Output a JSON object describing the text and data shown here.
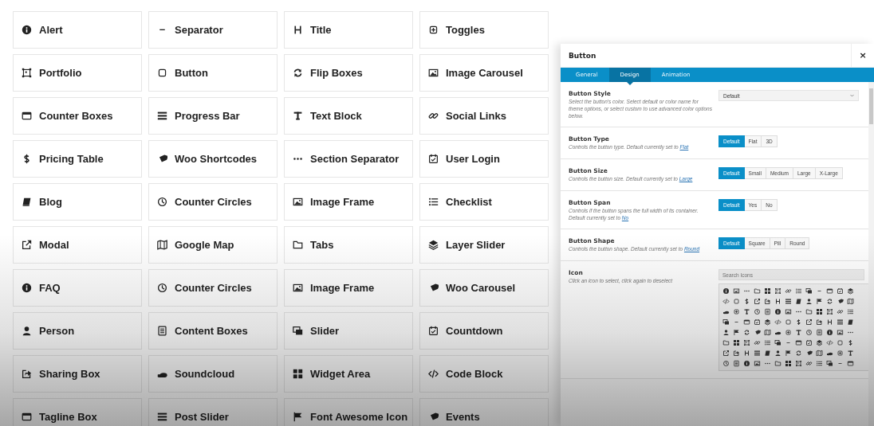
{
  "elements": [
    {
      "label": "Alert"
    },
    {
      "label": "Separator"
    },
    {
      "label": "Title"
    },
    {
      "label": "Toggles"
    },
    {
      "label": "Portfolio"
    },
    {
      "label": "Button"
    },
    {
      "label": "Flip Boxes"
    },
    {
      "label": "Image Carousel"
    },
    {
      "label": "Counter Boxes"
    },
    {
      "label": "Progress Bar"
    },
    {
      "label": "Text Block"
    },
    {
      "label": "Social Links"
    },
    {
      "label": "Pricing Table"
    },
    {
      "label": "Woo Shortcodes"
    },
    {
      "label": "Section Separator"
    },
    {
      "label": "User Login"
    },
    {
      "label": "Blog"
    },
    {
      "label": "Counter Circles"
    },
    {
      "label": "Image Frame"
    },
    {
      "label": "Checklist"
    },
    {
      "label": "Modal"
    },
    {
      "label": "Google Map"
    },
    {
      "label": "Tabs"
    },
    {
      "label": "Layer Slider"
    },
    {
      "label": "FAQ"
    },
    {
      "label": "Counter Circles"
    },
    {
      "label": "Image Frame"
    },
    {
      "label": "Woo Carousel"
    },
    {
      "label": "Person"
    },
    {
      "label": "Content Boxes"
    },
    {
      "label": "Slider"
    },
    {
      "label": "Countdown"
    },
    {
      "label": "Sharing Box"
    },
    {
      "label": "Soundcloud"
    },
    {
      "label": "Widget Area"
    },
    {
      "label": "Code Block"
    },
    {
      "label": "Tagline Box"
    },
    {
      "label": "Post Slider"
    },
    {
      "label": "Font Awesome Icon"
    },
    {
      "label": "Events"
    }
  ],
  "panel": {
    "title": "Button",
    "close": "×",
    "tabs": [
      {
        "label": "General",
        "selected": false
      },
      {
        "label": "Design",
        "selected": true
      },
      {
        "label": "Animation",
        "selected": false
      }
    ],
    "settings": [
      {
        "kind": "select",
        "label": "Button Style",
        "description": "Select the button's color. Select default or color name for theme options, or select custom to use advanced color options below.",
        "value": "Default"
      },
      {
        "kind": "buttons",
        "label": "Button Type",
        "description": "Controls the button type. Default currently set to",
        "link": "Flat",
        "options": [
          {
            "label": "Default",
            "selected": true
          },
          {
            "label": "Flat",
            "selected": false
          },
          {
            "label": "3D",
            "selected": false
          }
        ]
      },
      {
        "kind": "buttons",
        "label": "Button Size",
        "description": "Controls the button size. Default currently set to",
        "link": "Large",
        "options": [
          {
            "label": "Default",
            "selected": true
          },
          {
            "label": "Small",
            "selected": false
          },
          {
            "label": "Medium",
            "selected": false
          },
          {
            "label": "Large",
            "selected": false
          },
          {
            "label": "X-Large",
            "selected": false
          }
        ]
      },
      {
        "kind": "buttons",
        "label": "Button Span",
        "description": "Controls if the button spans the full width of its container. Default currently set to",
        "link": "No",
        "options": [
          {
            "label": "Default",
            "selected": true
          },
          {
            "label": "Yes",
            "selected": false
          },
          {
            "label": "No",
            "selected": false
          }
        ]
      },
      {
        "kind": "buttons",
        "label": "Button Shape",
        "description": "Controls the button shape. Default currently set to",
        "link": "Round",
        "options": [
          {
            "label": "Default",
            "selected": true
          },
          {
            "label": "Square",
            "selected": false
          },
          {
            "label": "Pill",
            "selected": false
          },
          {
            "label": "Round",
            "selected": false
          }
        ]
      },
      {
        "kind": "icons",
        "label": "Icon",
        "description": "Click an icon to select, click again to deselect",
        "placeholder": "Search Icons"
      }
    ]
  }
}
